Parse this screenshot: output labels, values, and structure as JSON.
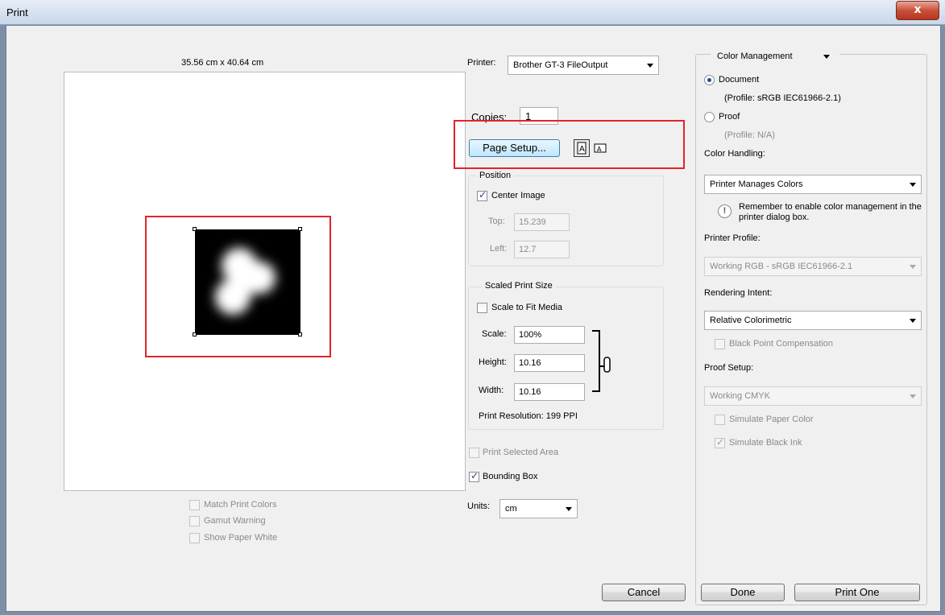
{
  "window": {
    "title": "Print",
    "close_glyph": "x"
  },
  "preview": {
    "paper_size": "35.56 cm x 40.64 cm",
    "options": [
      {
        "label": "Match Print Colors",
        "checked": false
      },
      {
        "label": "Gamut Warning",
        "checked": false
      },
      {
        "label": "Show Paper White",
        "checked": false
      }
    ]
  },
  "printer": {
    "label": "Printer:",
    "value": "Brother GT-3 FileOutput"
  },
  "copies": {
    "label": "Copies:",
    "value": "1"
  },
  "page_setup": {
    "label": "Page Setup...",
    "icon_portrait": "portrait-orientation-icon",
    "icon_landscape": "landscape-orientation-icon"
  },
  "position": {
    "title": "Position",
    "center_image": {
      "label": "Center Image",
      "checked": true
    },
    "top": {
      "label": "Top:",
      "value": "15.239"
    },
    "left": {
      "label": "Left:",
      "value": "12.7"
    }
  },
  "scaled": {
    "title": "Scaled Print Size",
    "scale_to_fit": {
      "label": "Scale to Fit Media",
      "checked": false
    },
    "scale": {
      "label": "Scale:",
      "value": "100%"
    },
    "height": {
      "label": "Height:",
      "value": "10.16"
    },
    "width": {
      "label": "Width:",
      "value": "10.16"
    },
    "resolution": "Print Resolution: 199 PPI",
    "link_icon": "chain-link-icon"
  },
  "print_selected": {
    "label": "Print Selected Area",
    "checked": false
  },
  "bounding_box": {
    "label": "Bounding Box",
    "checked": true
  },
  "units": {
    "label": "Units:",
    "value": "cm"
  },
  "color": {
    "section": "Color Management",
    "document": {
      "label": "Document",
      "profile": "(Profile: sRGB IEC61966-2.1)",
      "selected": true
    },
    "proof": {
      "label": "Proof",
      "profile": "(Profile: N/A)",
      "selected": false
    },
    "handling_label": "Color Handling:",
    "handling_value": "Printer Manages Colors",
    "notice": "Remember to enable color management in the printer dialog box.",
    "notice_icon": "info-icon",
    "profile_label": "Printer Profile:",
    "profile_value": "Working RGB - sRGB IEC61966-2.1",
    "intent_label": "Rendering Intent:",
    "intent_value": "Relative Colorimetric",
    "bpc": {
      "label": "Black Point Compensation",
      "checked": false
    },
    "proof_setup_label": "Proof Setup:",
    "proof_setup_value": "Working CMYK",
    "sim_paper": {
      "label": "Simulate Paper Color",
      "checked": false
    },
    "sim_ink": {
      "label": "Simulate Black Ink",
      "checked": true
    }
  },
  "footer": {
    "cancel": "Cancel",
    "done": "Done",
    "print_one": "Print One"
  },
  "colors": {
    "highlight": "#e0242b",
    "accent": "#1d4c9a"
  }
}
